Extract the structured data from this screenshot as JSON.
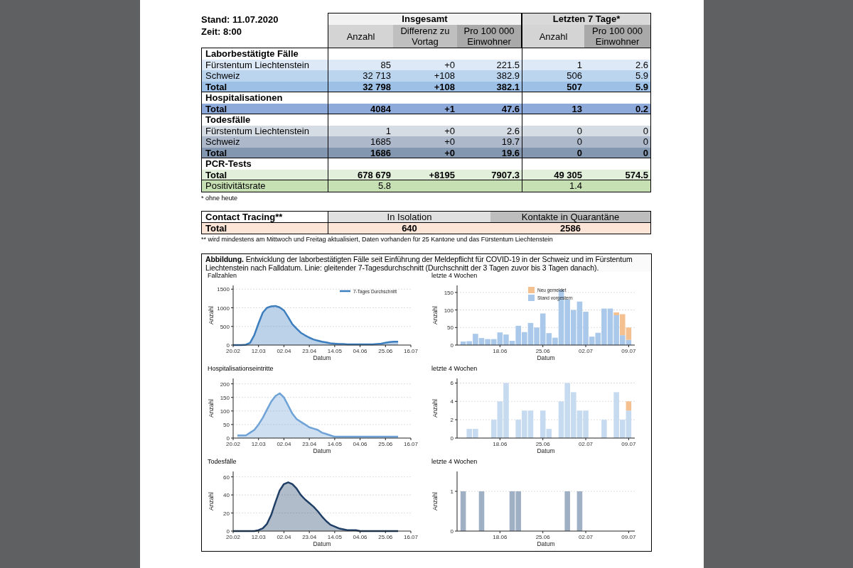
{
  "header": {
    "stand": "Stand: 11.07.2020",
    "zeit": "Zeit: 8:00"
  },
  "table": {
    "groups": [
      {
        "label": "Insgesamt"
      },
      {
        "label": "Letzten 7 Tage*"
      }
    ],
    "columns": [
      "Anzahl",
      "Differenz zu Vortag",
      "Pro 100 000 Einwohner",
      "Anzahl",
      "Pro 100 000 Einwohner"
    ],
    "rows": [
      {
        "kind": "heading",
        "label": "Laborbestätigte Fälle"
      },
      {
        "kind": "data",
        "label": "Fürstentum Liechtenstein",
        "color": "#dde9f6",
        "cells": [
          "85",
          "+0",
          "221.5",
          "1",
          "2.6"
        ]
      },
      {
        "kind": "data",
        "label": "Schweiz",
        "color": "#bcd5ef",
        "cells": [
          "32 713",
          "+108",
          "382.9",
          "506",
          "5.9"
        ]
      },
      {
        "kind": "total",
        "label": "Total",
        "color": "#9dc0e6",
        "cells": [
          "32 798",
          "+108",
          "382.1",
          "507",
          "5.9"
        ]
      },
      {
        "kind": "heading",
        "label": "Hospitalisationen"
      },
      {
        "kind": "total",
        "label": "Total",
        "color": "#8eaadb",
        "cells": [
          "4084",
          "+1",
          "47.6",
          "13",
          "0.2"
        ]
      },
      {
        "kind": "heading",
        "label": "Todesfälle"
      },
      {
        "kind": "data",
        "label": "Fürstentum Liechtenstein",
        "color": "#d6dce4",
        "cells": [
          "1",
          "+0",
          "2.6",
          "0",
          "0"
        ]
      },
      {
        "kind": "data",
        "label": "Schweiz",
        "color": "#adb9ca",
        "cells": [
          "1685",
          "+0",
          "19.7",
          "0",
          "0"
        ]
      },
      {
        "kind": "total",
        "label": "Total",
        "color": "#8497b0",
        "cells": [
          "1686",
          "+0",
          "19.6",
          "0",
          "0"
        ]
      },
      {
        "kind": "heading",
        "label": "PCR-Tests"
      },
      {
        "kind": "total",
        "label": "Total",
        "color": "#e2efda",
        "cells": [
          "678 679",
          "+8195",
          "7907.3",
          "49 305",
          "574.5"
        ]
      },
      {
        "kind": "data",
        "label": "Positivitätsrate",
        "color": "#c6e0b4",
        "cells": [
          "5.8",
          null,
          null,
          "1.4",
          null
        ]
      }
    ],
    "footnote": "* ohne heute"
  },
  "contact_tracing": {
    "title": "Contact Tracing**",
    "columns": [
      "In Isolation",
      "Kontakte in Quarantäne"
    ],
    "row_label": "Total",
    "values": [
      "640",
      "2586"
    ],
    "footnote": "** wird mindestens am Mittwoch und Freitag aktualisiert, Daten vorhanden für 25 Kantone und das Fürstentum Liechtenstein"
  },
  "figure": {
    "caption": "**Abbildung.** Entwicklung der laborbestätigten Fälle seit Einführung der Meldepflicht für COVID-19 in der Schweiz und im Fürstentum Liechtenstein nach Falldatum. Linie: gleitender 7-Tagesdurchschnitt (Durchschnitt der 3 Tagen zuvor bis 3 Tagen danach).",
    "charts": [
      {
        "title": "Fallzahlen",
        "chart_data": {
          "type": "area",
          "grid": true,
          "legend": "upper right",
          "xlabel": "Datum",
          "ylabel": "Anzahl",
          "ylim": [
            0,
            1600
          ],
          "yticks": [
            0,
            500,
            1000,
            1500
          ],
          "categories": [
            "20.02",
            null,
            null,
            null,
            null,
            null,
            "12.03",
            null,
            null,
            null,
            null,
            null,
            "02.04",
            null,
            null,
            null,
            null,
            null,
            "23.04",
            null,
            null,
            null,
            null,
            null,
            "14.05",
            null,
            null,
            null,
            null,
            null,
            "04.06",
            null,
            null,
            null,
            null,
            null,
            "25.06",
            null,
            null,
            null,
            null,
            null,
            "16.07"
          ],
          "series": [
            {
              "name": "7-Tages Durchschnitt",
              "color": "#3d7ebf",
              "values": [
                0,
                0,
                0,
                10,
                60,
                270,
                580,
                870,
                1000,
                1040,
                1050,
                1010,
                930,
                750,
                560,
                440,
                330,
                260,
                200,
                150,
                120,
                90,
                70,
                50,
                40,
                30,
                30,
                20,
                20,
                20,
                20,
                20,
                20,
                20,
                30,
                40,
                60,
                80,
                90,
                90,
                null,
                null,
                null
              ]
            }
          ]
        }
      },
      {
        "title": "letzte 4 Wochen",
        "chart_data": {
          "type": "bar",
          "stacked": true,
          "grid": true,
          "legend": "upper center",
          "xlabel": "Datum",
          "ylabel": "Anzahl",
          "ylim": [
            0,
            170
          ],
          "yticks": [
            0,
            50,
            100,
            150
          ],
          "categories": [
            null,
            null,
            null,
            null,
            null,
            null,
            "18.06",
            null,
            null,
            null,
            null,
            null,
            null,
            "25.06",
            null,
            null,
            null,
            null,
            null,
            null,
            "02.07",
            null,
            null,
            null,
            null,
            null,
            null,
            "09.07"
          ],
          "series": [
            {
              "name": "Stand vorgestern",
              "color": "#a9c8ea",
              "values": [
                10,
                11,
                32,
                20,
                17,
                17,
                36,
                30,
                12,
                55,
                37,
                63,
                50,
                90,
                34,
                21,
                158,
                130,
                100,
                124,
                95,
                24,
                35,
                104,
                104,
                85,
                28,
                15
              ]
            },
            {
              "name": "Neu gemeldet",
              "color": "#f4c08f",
              "values": [
                0,
                0,
                0,
                0,
                0,
                0,
                0,
                0,
                0,
                0,
                0,
                0,
                0,
                0,
                0,
                0,
                0,
                0,
                0,
                0,
                0,
                0,
                0,
                0,
                0,
                8,
                60,
                35
              ]
            }
          ]
        }
      },
      {
        "title": "Hospitalisationseintritte",
        "chart_data": {
          "type": "area",
          "grid": true,
          "xlabel": "Datum",
          "ylabel": "Anzahl",
          "ylim": [
            0,
            220
          ],
          "yticks": [
            0,
            50,
            100,
            150,
            200
          ],
          "categories": [
            "20.02",
            null,
            null,
            null,
            null,
            null,
            "12.03",
            null,
            null,
            null,
            null,
            null,
            "02.04",
            null,
            null,
            null,
            null,
            null,
            "23.04",
            null,
            null,
            null,
            null,
            null,
            "14.05",
            null,
            null,
            null,
            null,
            null,
            "04.06",
            null,
            null,
            null,
            null,
            null,
            "25.06",
            null,
            null,
            null,
            null,
            null,
            "16.07"
          ],
          "series": [
            {
              "color": "#6fa3d8",
              "values": [
                null,
                10,
                10,
                10,
                20,
                30,
                50,
                75,
                105,
                135,
                155,
                165,
                150,
                120,
                90,
                70,
                60,
                50,
                40,
                35,
                30,
                20,
                15,
                10,
                5,
                5,
                5,
                5,
                5,
                5,
                5,
                5,
                5,
                5,
                5,
                5,
                5,
                5,
                5,
                5,
                null,
                null,
                null
              ]
            }
          ]
        }
      },
      {
        "title": "letzte 4 Wochen",
        "chart_data": {
          "type": "bar",
          "stacked": true,
          "grid": true,
          "xlabel": "Datum",
          "ylabel": "Anzahl",
          "ylim": [
            0,
            6.5
          ],
          "yticks": [
            0,
            2,
            4,
            6
          ],
          "categories": [
            null,
            null,
            null,
            null,
            null,
            null,
            "18.06",
            null,
            null,
            null,
            null,
            null,
            null,
            "25.06",
            null,
            null,
            null,
            null,
            null,
            null,
            "02.07",
            null,
            null,
            null,
            null,
            null,
            null,
            "09.07"
          ],
          "series": [
            {
              "color": "#c6daf0",
              "values": [
                0,
                1,
                1,
                0,
                0,
                2,
                4,
                6,
                0,
                2,
                3,
                3,
                0,
                3,
                1,
                0,
                4,
                6,
                5,
                3,
                3,
                0,
                0,
                2,
                0,
                5,
                2,
                3
              ]
            },
            {
              "color": "#f4c08f",
              "values": [
                0,
                0,
                0,
                0,
                0,
                0,
                0,
                0,
                0,
                0,
                0,
                0,
                0,
                0,
                0,
                0,
                0,
                0,
                0,
                0,
                0,
                0,
                0,
                0,
                0,
                0,
                0,
                1
              ]
            }
          ]
        }
      },
      {
        "title": "Todesfälle",
        "chart_data": {
          "type": "area",
          "grid": true,
          "xlabel": "Datum",
          "ylabel": "Anzahl",
          "ylim": [
            0,
            66
          ],
          "yticks": [
            0,
            20,
            40,
            60
          ],
          "categories": [
            "20.02",
            null,
            null,
            null,
            null,
            null,
            "12.03",
            null,
            null,
            null,
            null,
            null,
            "02.04",
            null,
            null,
            null,
            null,
            null,
            "23.04",
            null,
            null,
            null,
            null,
            null,
            "14.05",
            null,
            null,
            null,
            null,
            null,
            "04.06",
            null,
            null,
            null,
            null,
            null,
            "25.06",
            null,
            null,
            null,
            null,
            null,
            "16.07"
          ],
          "series": [
            {
              "color": "#1f3f66",
              "values": [
                0,
                0,
                0,
                0,
                0,
                0,
                1,
                3,
                8,
                18,
                32,
                45,
                52,
                54,
                52,
                47,
                40,
                35,
                31,
                27,
                22,
                16,
                11,
                7,
                5,
                3,
                2,
                1,
                1,
                1,
                0,
                0,
                0,
                0,
                0,
                0,
                0,
                0,
                0,
                0,
                null,
                null,
                null
              ]
            }
          ]
        }
      },
      {
        "title": "letzte 4 Wochen",
        "chart_data": {
          "type": "bar",
          "stacked": true,
          "grid": true,
          "xlabel": "Datum",
          "ylabel": "Anzahl",
          "ylim": [
            0,
            1.5
          ],
          "yticks": [
            0,
            1
          ],
          "categories": [
            null,
            null,
            null,
            null,
            null,
            null,
            "18.06",
            null,
            null,
            null,
            null,
            null,
            null,
            "25.06",
            null,
            null,
            null,
            null,
            null,
            null,
            "02.07",
            null,
            null,
            null,
            null,
            null,
            null,
            "09.07"
          ],
          "series": [
            {
              "color": "#9fb0c4",
              "values": [
                1,
                0,
                0,
                1,
                0,
                0,
                0,
                0,
                1,
                1,
                0,
                0,
                0,
                0,
                0,
                0,
                0,
                1,
                0,
                1,
                0,
                0,
                0,
                0,
                0,
                0,
                0,
                0
              ]
            }
          ]
        }
      }
    ]
  }
}
